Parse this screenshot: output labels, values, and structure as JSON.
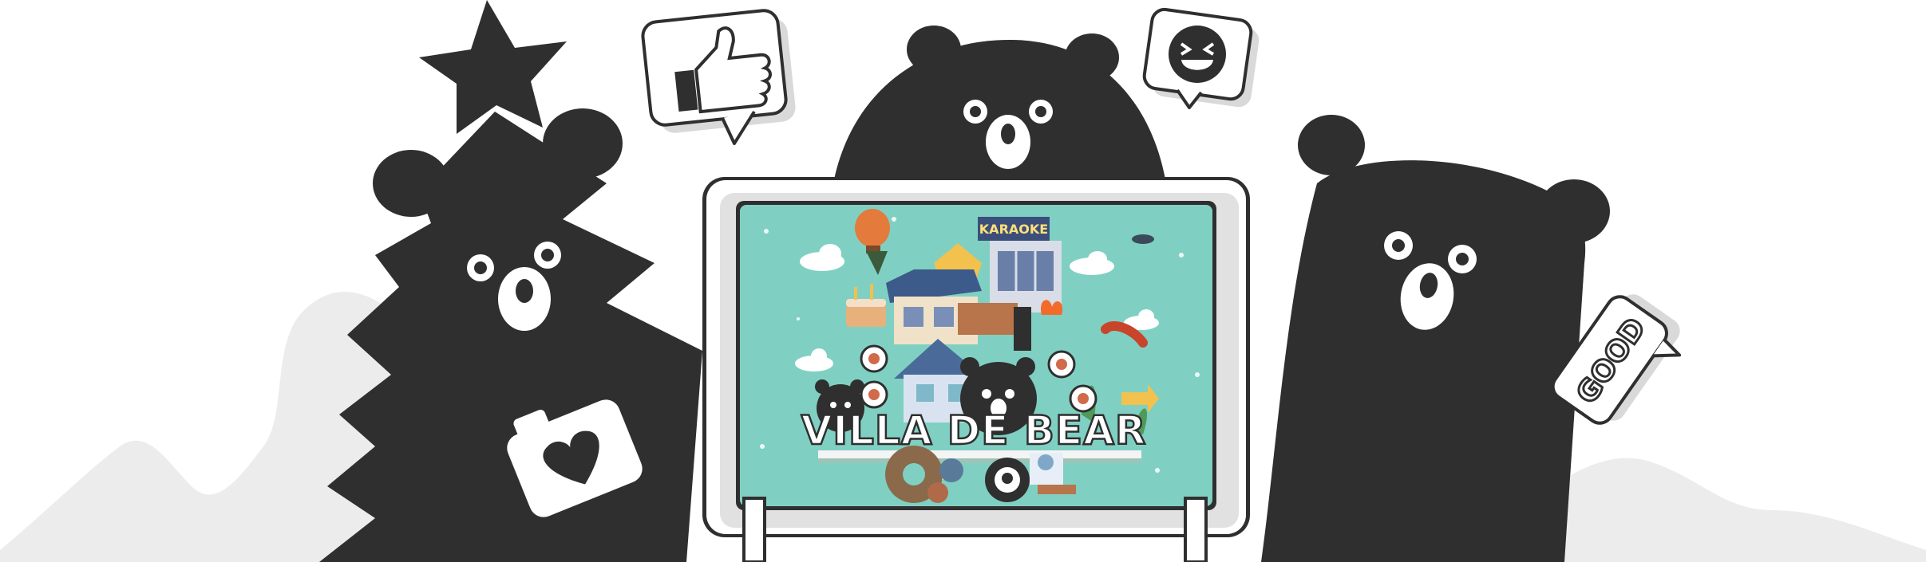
{
  "poster": {
    "title": "VILLA DE BEAR",
    "sign_text": "KARAOKE"
  },
  "bubbles": {
    "good_label": "GOOD",
    "thumbs_up_icon": "thumbs-up-icon",
    "laughing_face_icon": "laughing-face-icon"
  },
  "camera_icon": "camera-heart-icon",
  "colors": {
    "bear": "#2f2f2f",
    "background_hills": "#ececec",
    "bubble_shadow": "#d9d9d9",
    "poster_sky": "#7fd0c2",
    "frame": "#ffffff",
    "frame_shadow": "#e1e1e1",
    "title_text": "#ffffff"
  }
}
